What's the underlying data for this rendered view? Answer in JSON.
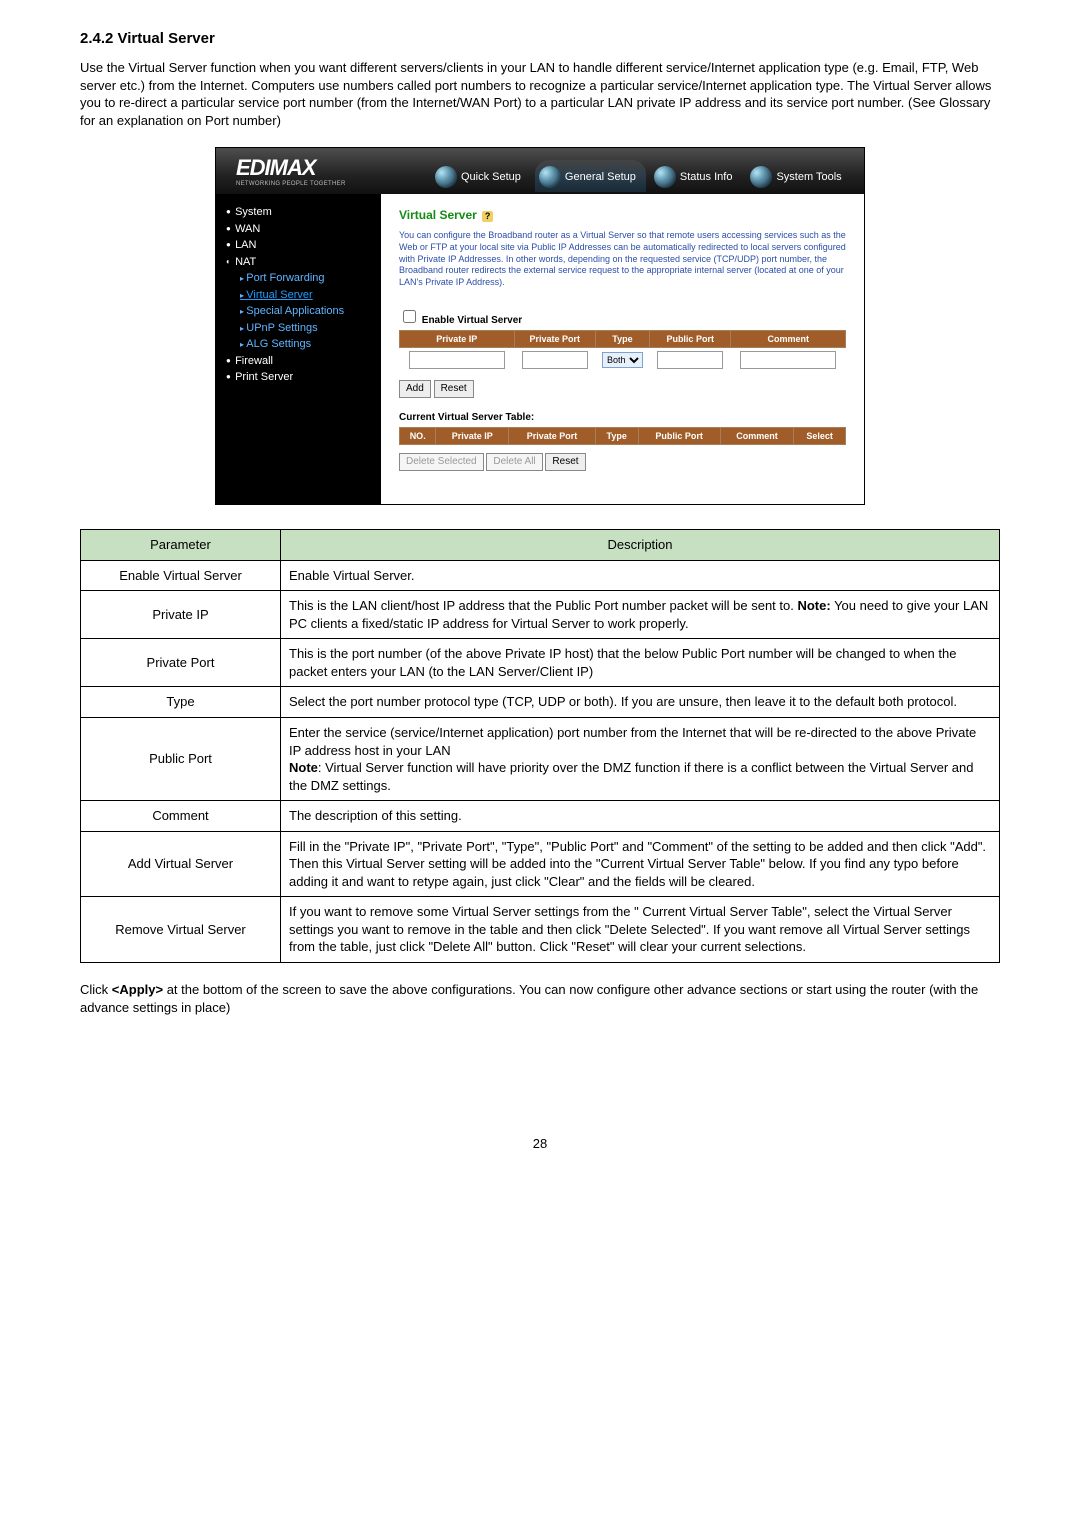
{
  "heading": "2.4.2 Virtual Server",
  "intro": "Use the Virtual Server function when you want different servers/clients in your LAN to handle different service/Internet application type (e.g. Email, FTP, Web server etc.) from the Internet. Computers use numbers called port numbers to recognize a particular service/Internet application type. The Virtual Server allows you to re-direct a particular service port number (from the Internet/WAN Port) to a particular LAN private IP address and its service port number. (See Glossary for an explanation on Port number)",
  "screenshot": {
    "logo": "EDIMAX",
    "logo_sub": "NETWORKING PEOPLE TOGETHER",
    "tabs": {
      "quick": "Quick Setup",
      "general": "General Setup",
      "status": "Status Info",
      "tools": "System Tools"
    },
    "sidebar": {
      "system": "System",
      "wan": "WAN",
      "lan": "LAN",
      "nat": "NAT",
      "port_forwarding": "Port Forwarding",
      "virtual_server": "Virtual Server",
      "special_apps": "Special Applications",
      "upnp": "UPnP Settings",
      "alg": "ALG Settings",
      "firewall": "Firewall",
      "print_server": "Print Server"
    },
    "panel": {
      "title": "Virtual Server",
      "help": "?",
      "intro": "You can configure the Broadband router as a Virtual Server so that remote users accessing services such as the Web or FTP at your local site via Public IP Addresses can be automatically redirected to local servers configured with Private IP Addresses. In other words, depending on the requested service (TCP/UDP) port number, the Broadband router redirects the external service request to the appropriate internal server (located at one of your LAN's Private IP Address).",
      "enable_label": "Enable Virtual Server",
      "cols": {
        "no": "NO.",
        "private_ip": "Private IP",
        "private_port": "Private Port",
        "type": "Type",
        "public_port": "Public Port",
        "comment": "Comment",
        "select": "Select"
      },
      "type_value": "Both",
      "add_btn": "Add",
      "reset_btn": "Reset",
      "current_title": "Current Virtual Server Table:",
      "delete_selected_btn": "Delete Selected",
      "delete_all_btn": "Delete All",
      "reset2_btn": "Reset"
    }
  },
  "table": {
    "head_param": "Parameter",
    "head_desc": "Description",
    "rows": [
      {
        "name": "Enable Virtual Server",
        "desc": "Enable Virtual Server."
      },
      {
        "name": "Private IP",
        "desc": "This is the LAN client/host IP address that the Public Port number packet will be sent to. Note: You need to give your LAN PC clients a fixed/static IP address for Virtual Server to work properly.",
        "bold_range": [
          97,
          102
        ]
      },
      {
        "name": "Private Port",
        "desc": "This is the port number (of the above Private IP host) that the below Public Port number will be changed to when the packet enters your LAN (to the LAN Server/Client IP)"
      },
      {
        "name": "Type",
        "desc": "Select the port number protocol type (TCP, UDP or both). If you are unsure, then leave it to the default both protocol."
      },
      {
        "name": "Public Port",
        "desc": "Enter the service (service/Internet application) port number from the Internet that will be re-directed to the above Private IP address host in your LAN\nNote: Virtual Server function will have priority over the DMZ function if there is a conflict between the Virtual Server and the DMZ settings.",
        "bold_prefix": "Note"
      },
      {
        "name": "Comment",
        "desc": "The description of this setting."
      },
      {
        "name": "Add Virtual Server",
        "desc": "Fill in the \"Private IP\", \"Private Port\", \"Type\", \"Public Port\" and \"Comment\" of the setting to be added and then click \"Add\". Then this Virtual Server setting will be added into the \"Current Virtual Server Table\" below. If you find any typo before adding it and want to retype again, just click \"Clear\" and the fields will be cleared."
      },
      {
        "name": "Remove Virtual Server",
        "desc": "If you want to remove some Virtual Server settings from the \" Current Virtual Server Table\", select the Virtual Server settings you want to remove in the table and then click \"Delete Selected\". If you want remove all Virtual Server settings from the table, just click \"Delete All\" button. Click \"Reset\" will clear your current selections."
      }
    ]
  },
  "footnote_pre": "Click ",
  "footnote_bold": "<Apply>",
  "footnote_post": " at the bottom of the screen to save the above configurations. You can now configure other advance sections or start using the router (with the advance settings in place)",
  "pagenum": "28"
}
